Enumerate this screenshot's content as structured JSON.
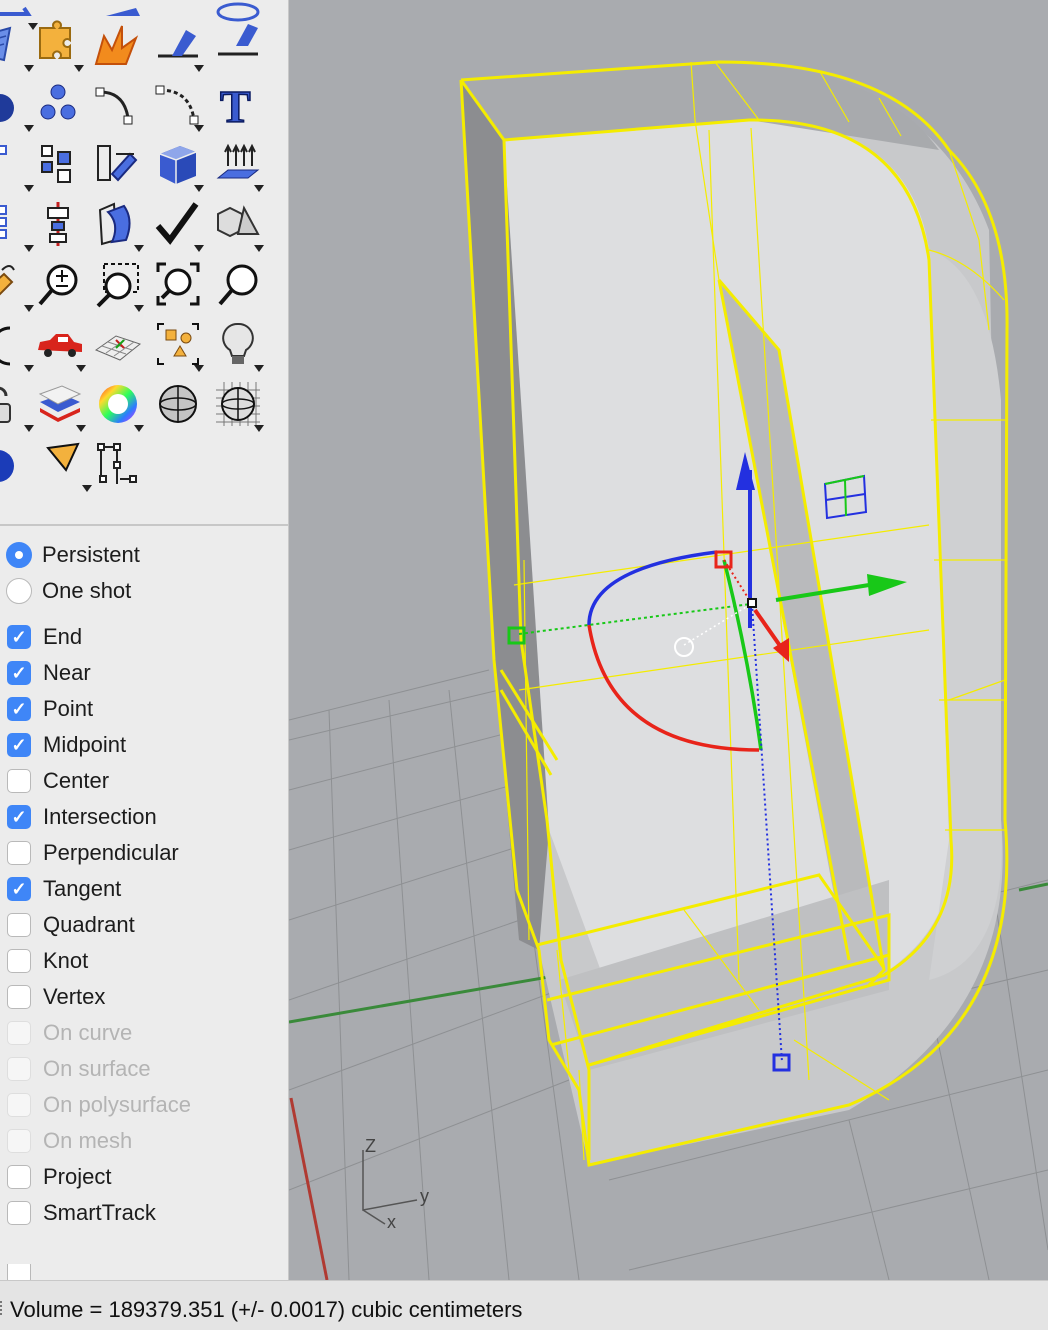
{
  "osnap": {
    "mode_options": [
      {
        "label": "Persistent",
        "selected": true
      },
      {
        "label": "One shot",
        "selected": false
      }
    ],
    "snaps": [
      {
        "label": "End",
        "checked": true,
        "enabled": true
      },
      {
        "label": "Near",
        "checked": true,
        "enabled": true
      },
      {
        "label": "Point",
        "checked": true,
        "enabled": true
      },
      {
        "label": "Midpoint",
        "checked": true,
        "enabled": true
      },
      {
        "label": "Center",
        "checked": false,
        "enabled": true
      },
      {
        "label": "Intersection",
        "checked": true,
        "enabled": true
      },
      {
        "label": "Perpendicular",
        "checked": false,
        "enabled": true
      },
      {
        "label": "Tangent",
        "checked": true,
        "enabled": true
      },
      {
        "label": "Quadrant",
        "checked": false,
        "enabled": true
      },
      {
        "label": "Knot",
        "checked": false,
        "enabled": true
      },
      {
        "label": "Vertex",
        "checked": false,
        "enabled": true
      },
      {
        "label": "On curve",
        "checked": false,
        "enabled": false
      },
      {
        "label": "On surface",
        "checked": false,
        "enabled": false
      },
      {
        "label": "On polysurface",
        "checked": false,
        "enabled": false
      },
      {
        "label": "On mesh",
        "checked": false,
        "enabled": false
      },
      {
        "label": "Project",
        "checked": false,
        "enabled": true
      },
      {
        "label": "SmartTrack",
        "checked": false,
        "enabled": true
      }
    ]
  },
  "viewport": {
    "axis_labels": {
      "z": "Z",
      "y": "y",
      "x": "x"
    }
  },
  "status": {
    "text": "Volume = 189379.351 (+/- 0.0017) cubic centimeters"
  },
  "colors": {
    "selection": "#f4ec00",
    "viewport_bg": "#a9abaf",
    "grid_line": "#8e9093",
    "x_axis": "#b03a32",
    "y_axis": "#3a8a3a",
    "gumball_x": "#e8241a",
    "gumball_y": "#18c818",
    "gumball_z": "#2330e0",
    "accent": "#3f86f7"
  },
  "toolbar": {
    "tools": [
      {
        "name": "surface-patch-icon",
        "interactable": true
      },
      {
        "name": "puzzle-icon",
        "interactable": true
      },
      {
        "name": "explode-icon",
        "interactable": true
      },
      {
        "name": "split-icon",
        "interactable": true
      },
      {
        "name": "trim-icon",
        "interactable": true
      },
      {
        "name": "spheres-icon",
        "interactable": true
      },
      {
        "name": "points-icon",
        "interactable": true
      },
      {
        "name": "curve-point-icon",
        "interactable": true
      },
      {
        "name": "arc-points-icon",
        "interactable": true
      },
      {
        "name": "text-icon",
        "interactable": true
      },
      {
        "name": "block-icon",
        "interactable": true
      },
      {
        "name": "group-icon",
        "interactable": true
      },
      {
        "name": "transform-icon",
        "interactable": true
      },
      {
        "name": "solid-box-icon",
        "interactable": true
      },
      {
        "name": "extrude-icon",
        "interactable": true
      },
      {
        "name": "array-icon",
        "interactable": true
      },
      {
        "name": "align-icon",
        "interactable": true
      },
      {
        "name": "bend-icon",
        "interactable": true
      },
      {
        "name": "check-icon",
        "interactable": true
      },
      {
        "name": "shapes-icon",
        "interactable": true
      },
      {
        "name": "pan-icon",
        "interactable": true
      },
      {
        "name": "zoom-dynamic-icon",
        "interactable": true
      },
      {
        "name": "zoom-window-icon",
        "interactable": true
      },
      {
        "name": "zoom-extents-icon",
        "interactable": true
      },
      {
        "name": "zoom-selected-icon",
        "interactable": true
      },
      {
        "name": "rotate-view-icon",
        "interactable": true
      },
      {
        "name": "car-icon",
        "interactable": true
      },
      {
        "name": "grid-icon",
        "interactable": true
      },
      {
        "name": "snapshot-icon",
        "interactable": true
      },
      {
        "name": "light-bulb-icon",
        "interactable": true
      },
      {
        "name": "lock-icon",
        "interactable": true
      },
      {
        "name": "layers-icon",
        "interactable": true
      },
      {
        "name": "color-wheel-icon",
        "interactable": true
      },
      {
        "name": "shaded-sphere-icon",
        "interactable": true
      },
      {
        "name": "wire-sphere-icon",
        "interactable": true
      },
      {
        "name": "render-sphere-icon",
        "interactable": true
      },
      {
        "name": "cone-icon",
        "interactable": true
      },
      {
        "name": "dimension-icon",
        "interactable": true
      }
    ]
  }
}
